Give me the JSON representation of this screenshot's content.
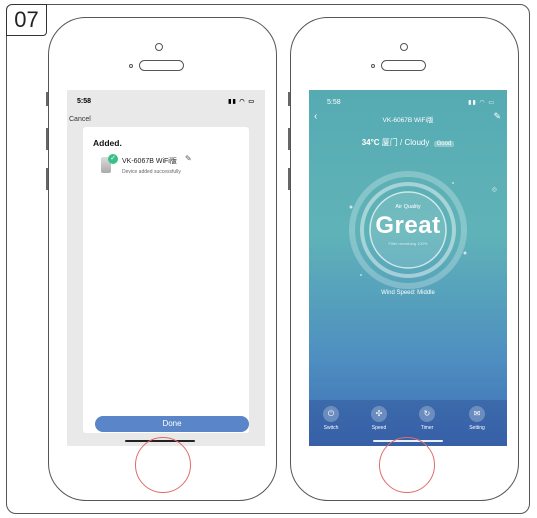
{
  "step": {
    "number": "07"
  },
  "left_phone": {
    "status_time": "5:58",
    "status_icons": "▮▮ ◠ ▭",
    "cancel": "Cancel",
    "card_title": "Added.",
    "device_name": "VK-6067B WiFi版",
    "device_status": "Device added successfully",
    "done": "Done"
  },
  "right_phone": {
    "status_time": "5:58",
    "status_icons": "▮▮ ◠ ▭",
    "title": "VK-6067B WiFi版",
    "temperature": "34°C",
    "weather_desc": "厦门 / Cloudy",
    "aqi_badge": "Good",
    "air_quality_label": "Air Quality",
    "air_quality_value": "Great",
    "filter_remaining": "Filter remaining 100%",
    "wind_speed": "Wind Speed: Middle",
    "controls": [
      {
        "label": "Switch",
        "icon": "power-icon",
        "glyph": "⏻"
      },
      {
        "label": "Speed",
        "icon": "fan-icon",
        "glyph": "✣"
      },
      {
        "label": "Timer",
        "icon": "timer-icon",
        "glyph": "↻"
      },
      {
        "label": "Setting",
        "icon": "setting-icon",
        "glyph": "✉"
      }
    ]
  },
  "colors": {
    "done_button": "#5a86c9",
    "success_check": "#3bbf88",
    "home_button_ring": "#e06b6b",
    "screen_gradient_top": "#56aab2",
    "screen_gradient_bottom": "#3f6eb6"
  }
}
